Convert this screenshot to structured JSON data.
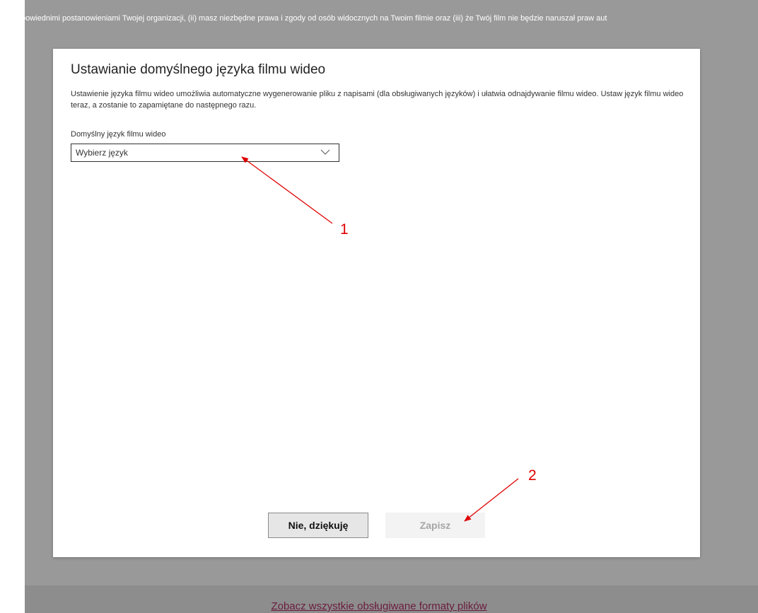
{
  "background": {
    "notice_text": "e z odpowiednimi postanowieniami Twojej organizacji, (ii) masz niezbędne prawa i zgody od osób widocznych na Twoim filmie oraz (iii) że Twój film nie będzie naruszał praw aut",
    "footer_link": "Zobacz wszystkie obsługiwane formaty plików"
  },
  "dialog": {
    "title": "Ustawianie domyślnego języka filmu wideo",
    "description": "Ustawienie języka filmu wideo umożliwia automatyczne wygenerowanie pliku z napisami (dla obsługiwanych języków) i ułatwia odnajdywanie filmu wideo. Ustaw język filmu wideo teraz, a zostanie to zapamiętane do następnego razu.",
    "language_field": {
      "label": "Domyślny język filmu wideo",
      "selected_value": "Wybierz język",
      "icon": "chevron-down-icon"
    },
    "buttons": {
      "decline_label": "Nie, dziękuję",
      "save_label": "Zapisz",
      "save_enabled": false
    }
  },
  "annotations": {
    "color": "#e00000",
    "marker_1": "1",
    "marker_2": "2"
  }
}
